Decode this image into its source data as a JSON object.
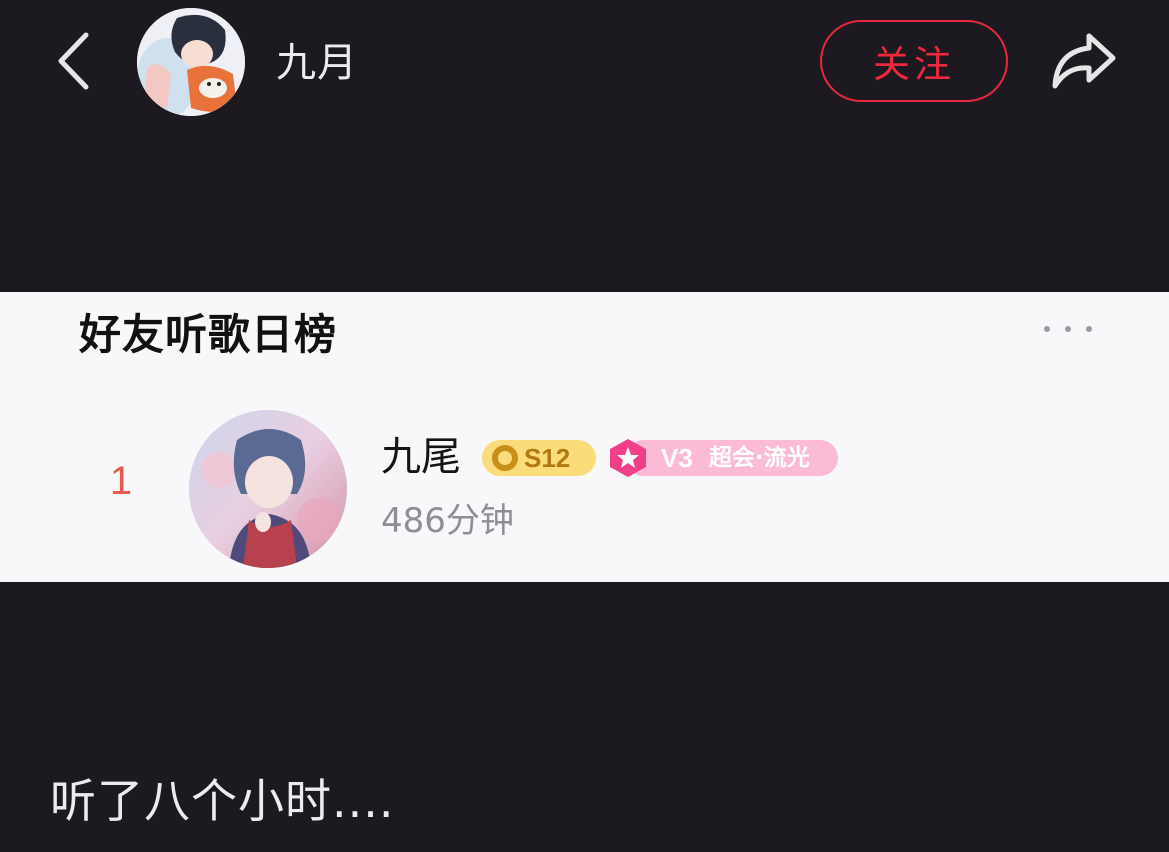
{
  "header": {
    "back_icon": "chevron-left-icon",
    "avatar": "user-avatar-anime-boy-with-fox",
    "name": "九月",
    "follow_label": "关注",
    "share_icon": "share-arrow-icon",
    "accent_color": "#e8283c"
  },
  "card": {
    "title": "好友听歌日榜",
    "more_icon": "more-dots-icon",
    "entries": [
      {
        "rank": "1",
        "avatar": "user-avatar-anime-boy",
        "name": "九尾",
        "level_badge": "S12",
        "vip_level": "V3",
        "vip_tier": "超会·流光",
        "listen_time": "486分钟"
      }
    ]
  },
  "caption": "听了八个小时...."
}
